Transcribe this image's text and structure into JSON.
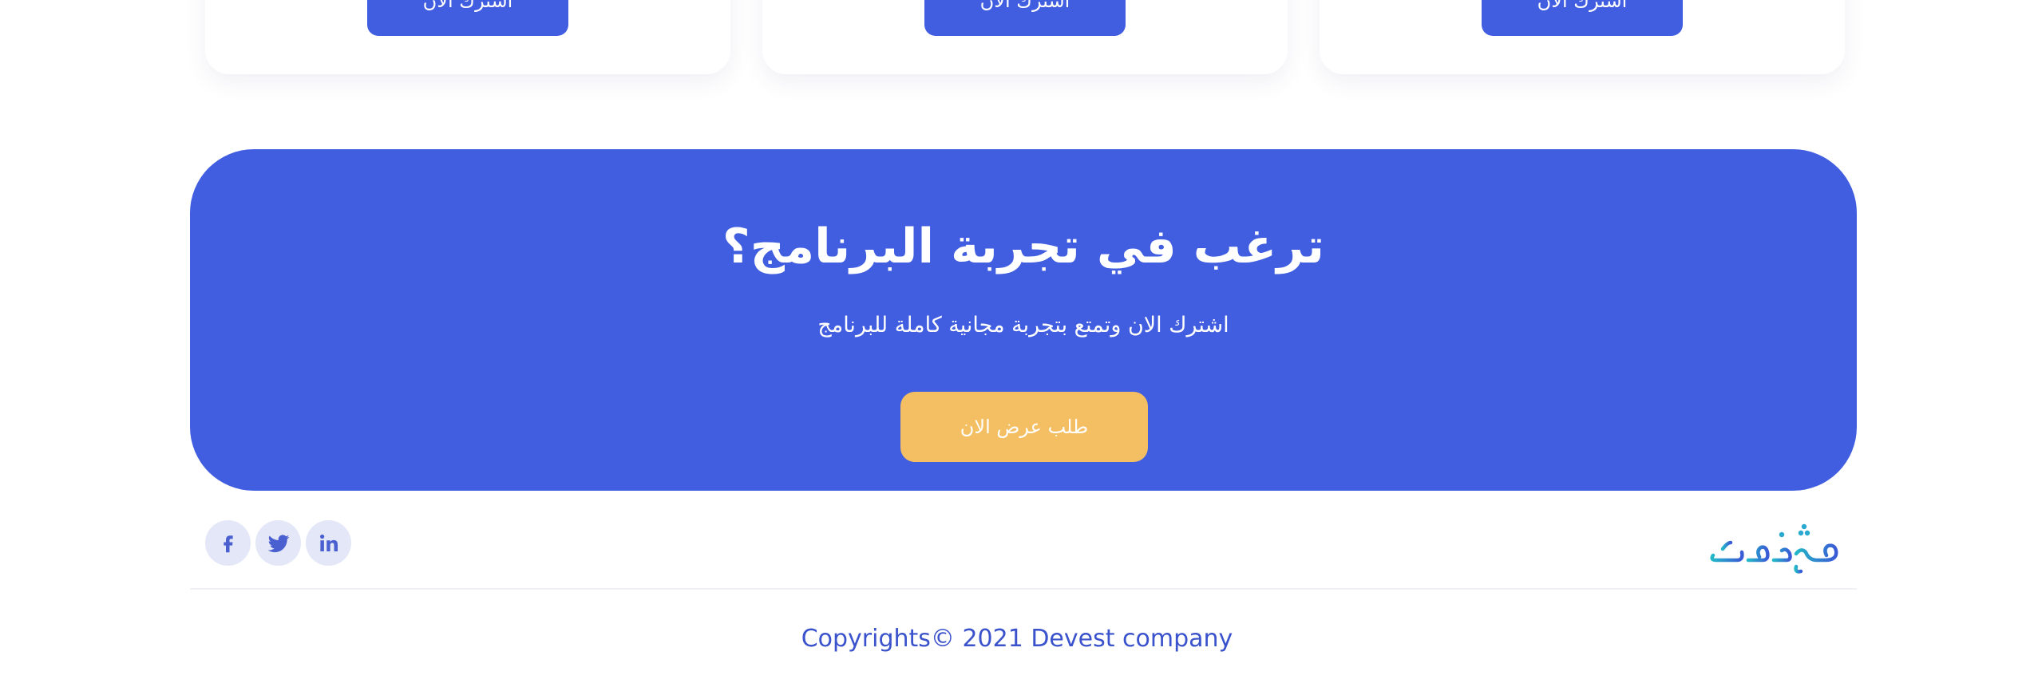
{
  "plan_cards": [
    {
      "subscribe_label": "اشترك الان"
    },
    {
      "subscribe_label": "اشترك الان"
    },
    {
      "subscribe_label": "اشترك الان"
    }
  ],
  "cta": {
    "title": "ترغب في تجربة البرنامج؟",
    "subtitle": "اشترك الان وتمتع بتجربة مجانية كاملة للبرنامج",
    "button_label": "طلب عرض الان",
    "background_color": "#415ee0",
    "button_color": "#f4bf63"
  },
  "footer": {
    "social_icons": [
      "facebook-icon",
      "twitter-icon",
      "linkedin-icon"
    ],
    "logo_text": "منزارك",
    "copyright": "Copyrights© 2021 Devest company",
    "accent_color": "#3a52cc"
  }
}
